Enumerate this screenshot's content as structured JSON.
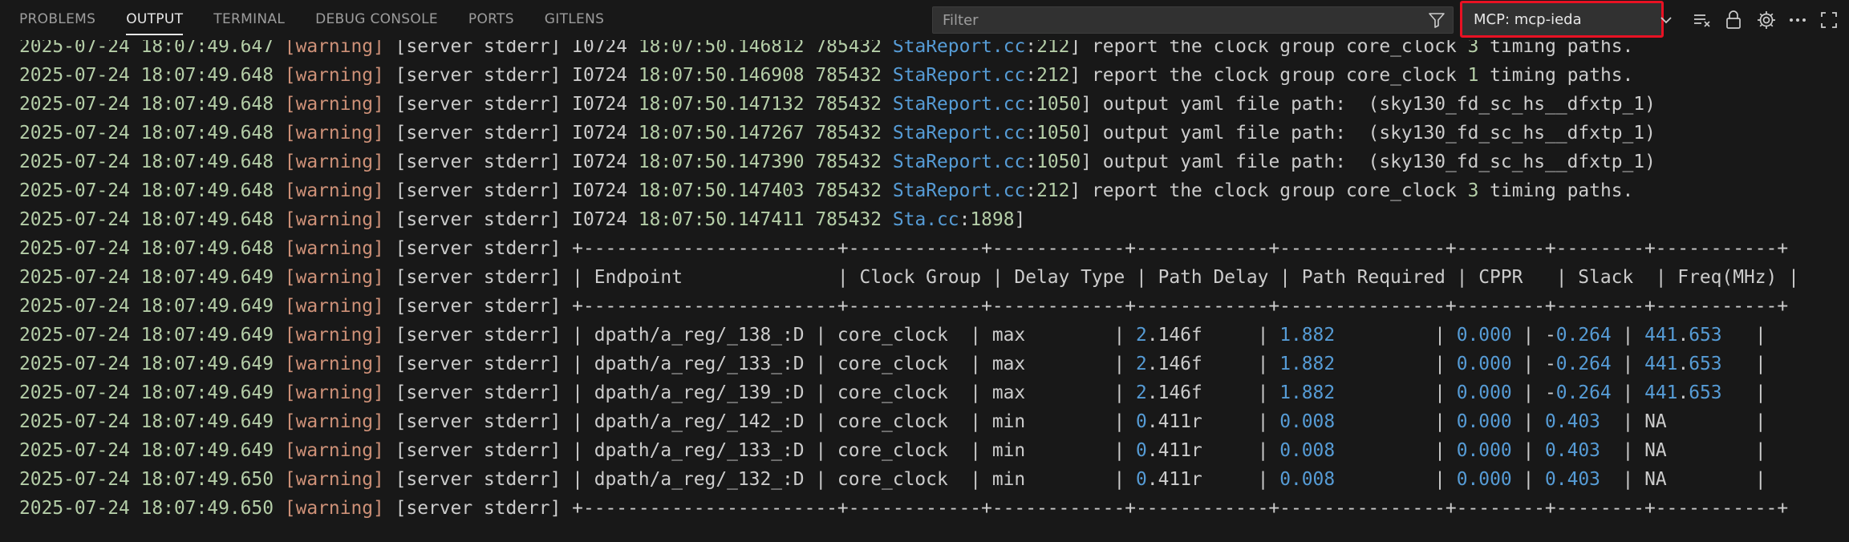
{
  "tabs": [
    {
      "label": "PROBLEMS",
      "active": false
    },
    {
      "label": "OUTPUT",
      "active": true
    },
    {
      "label": "TERMINAL",
      "active": false
    },
    {
      "label": "DEBUG CONSOLE",
      "active": false
    },
    {
      "label": "PORTS",
      "active": false
    },
    {
      "label": "GITLENS",
      "active": false
    }
  ],
  "filter": {
    "placeholder": "Filter",
    "value": ""
  },
  "channel": {
    "selected": "MCP: mcp-ieda"
  },
  "toolbar_icons": [
    "filter-icon",
    "chevron-down-icon",
    "clear-output-icon",
    "lock-icon",
    "gear-icon",
    "more-icon",
    "maximize-icon"
  ],
  "colors": {
    "timestamp": "#b5cea8",
    "warning": "#ce9178",
    "link": "#569cd6",
    "highlight_border": "#e81123"
  },
  "log_lines": [
    {
      "ts": "2025-07-24 18:07:49.647",
      "level": "[warning]",
      "src": "[server stderr]",
      "parts": [
        [
          "msg",
          "I0724 "
        ],
        [
          "num",
          "18:07:50.146812"
        ],
        [
          "msg",
          " "
        ],
        [
          "num",
          "785432"
        ],
        [
          "msg",
          " "
        ],
        [
          "link",
          "StaReport.cc"
        ],
        [
          "msg",
          ":"
        ],
        [
          "num",
          "212"
        ],
        [
          "msg",
          "] report the clock group core_clock "
        ],
        [
          "num",
          "3"
        ],
        [
          "msg",
          " timing paths."
        ]
      ]
    },
    {
      "ts": "2025-07-24 18:07:49.648",
      "level": "[warning]",
      "src": "[server stderr]",
      "parts": [
        [
          "msg",
          "I0724 "
        ],
        [
          "num",
          "18:07:50.146908"
        ],
        [
          "msg",
          " "
        ],
        [
          "num",
          "785432"
        ],
        [
          "msg",
          " "
        ],
        [
          "link",
          "StaReport.cc"
        ],
        [
          "msg",
          ":"
        ],
        [
          "num",
          "212"
        ],
        [
          "msg",
          "] report the clock group core_clock "
        ],
        [
          "num",
          "1"
        ],
        [
          "msg",
          " timing paths."
        ]
      ]
    },
    {
      "ts": "2025-07-24 18:07:49.648",
      "level": "[warning]",
      "src": "[server stderr]",
      "parts": [
        [
          "msg",
          "I0724 "
        ],
        [
          "num",
          "18:07:50.147132"
        ],
        [
          "msg",
          " "
        ],
        [
          "num",
          "785432"
        ],
        [
          "msg",
          " "
        ],
        [
          "link",
          "StaReport.cc"
        ],
        [
          "msg",
          ":"
        ],
        [
          "num",
          "1050"
        ],
        [
          "msg",
          "] output yaml file path:  (sky130_fd_sc_hs__dfxtp_1)"
        ]
      ]
    },
    {
      "ts": "2025-07-24 18:07:49.648",
      "level": "[warning]",
      "src": "[server stderr]",
      "parts": [
        [
          "msg",
          "I0724 "
        ],
        [
          "num",
          "18:07:50.147267"
        ],
        [
          "msg",
          " "
        ],
        [
          "num",
          "785432"
        ],
        [
          "msg",
          " "
        ],
        [
          "link",
          "StaReport.cc"
        ],
        [
          "msg",
          ":"
        ],
        [
          "num",
          "1050"
        ],
        [
          "msg",
          "] output yaml file path:  (sky130_fd_sc_hs__dfxtp_1)"
        ]
      ]
    },
    {
      "ts": "2025-07-24 18:07:49.648",
      "level": "[warning]",
      "src": "[server stderr]",
      "parts": [
        [
          "msg",
          "I0724 "
        ],
        [
          "num",
          "18:07:50.147390"
        ],
        [
          "msg",
          " "
        ],
        [
          "num",
          "785432"
        ],
        [
          "msg",
          " "
        ],
        [
          "link",
          "StaReport.cc"
        ],
        [
          "msg",
          ":"
        ],
        [
          "num",
          "1050"
        ],
        [
          "msg",
          "] output yaml file path:  (sky130_fd_sc_hs__dfxtp_1)"
        ]
      ]
    },
    {
      "ts": "2025-07-24 18:07:49.648",
      "level": "[warning]",
      "src": "[server stderr]",
      "parts": [
        [
          "msg",
          "I0724 "
        ],
        [
          "num",
          "18:07:50.147403"
        ],
        [
          "msg",
          " "
        ],
        [
          "num",
          "785432"
        ],
        [
          "msg",
          " "
        ],
        [
          "link",
          "StaReport.cc"
        ],
        [
          "msg",
          ":"
        ],
        [
          "num",
          "212"
        ],
        [
          "msg",
          "] report the clock group core_clock "
        ],
        [
          "num",
          "3"
        ],
        [
          "msg",
          " timing paths."
        ]
      ]
    },
    {
      "ts": "2025-07-24 18:07:49.648",
      "level": "[warning]",
      "src": "[server stderr]",
      "parts": [
        [
          "msg",
          "I0724 "
        ],
        [
          "num",
          "18:07:50.147411"
        ],
        [
          "msg",
          " "
        ],
        [
          "num",
          "785432"
        ],
        [
          "msg",
          " "
        ],
        [
          "link",
          "Sta.cc"
        ],
        [
          "msg",
          ":"
        ],
        [
          "num",
          "1898"
        ],
        [
          "msg",
          "]"
        ]
      ]
    },
    {
      "ts": "2025-07-24 18:07:49.648",
      "level": "[warning]",
      "src": "[server stderr]",
      "parts": [
        [
          "msg",
          "+-----------------------+------------+------------+------------+---------------+--------+--------+-----------+"
        ]
      ]
    },
    {
      "ts": "2025-07-24 18:07:49.649",
      "level": "[warning]",
      "src": "[server stderr]",
      "parts": [
        [
          "msg",
          "| Endpoint              | Clock Group | Delay Type | Path Delay | Path Required | CPPR   | Slack  | Freq(MHz) |"
        ]
      ]
    },
    {
      "ts": "2025-07-24 18:07:49.649",
      "level": "[warning]",
      "src": "[server stderr]",
      "parts": [
        [
          "msg",
          "+-----------------------+------------+------------+------------+---------------+--------+--------+-----------+"
        ]
      ]
    },
    {
      "ts": "2025-07-24 18:07:49.649",
      "level": "[warning]",
      "src": "[server stderr]",
      "parts": [
        [
          "msg",
          "| dpath/a_reg/_138_:D | core_clock  | max        | "
        ],
        [
          "cell",
          "2"
        ],
        [
          "msg",
          ".146f     | "
        ],
        [
          "cell",
          "1.882"
        ],
        [
          "msg",
          "         | "
        ],
        [
          "cell",
          "0.000"
        ],
        [
          "msg",
          " | -"
        ],
        [
          "cell",
          "0.264"
        ],
        [
          "msg",
          " | "
        ],
        [
          "cell",
          "441"
        ],
        [
          "msg",
          "."
        ],
        [
          "cell",
          "653"
        ],
        [
          "msg",
          "   |"
        ]
      ]
    },
    {
      "ts": "2025-07-24 18:07:49.649",
      "level": "[warning]",
      "src": "[server stderr]",
      "parts": [
        [
          "msg",
          "| dpath/a_reg/_133_:D | core_clock  | max        | "
        ],
        [
          "cell",
          "2"
        ],
        [
          "msg",
          ".146f     | "
        ],
        [
          "cell",
          "1.882"
        ],
        [
          "msg",
          "         | "
        ],
        [
          "cell",
          "0.000"
        ],
        [
          "msg",
          " | -"
        ],
        [
          "cell",
          "0.264"
        ],
        [
          "msg",
          " | "
        ],
        [
          "cell",
          "441"
        ],
        [
          "msg",
          "."
        ],
        [
          "cell",
          "653"
        ],
        [
          "msg",
          "   |"
        ]
      ]
    },
    {
      "ts": "2025-07-24 18:07:49.649",
      "level": "[warning]",
      "src": "[server stderr]",
      "parts": [
        [
          "msg",
          "| dpath/a_reg/_139_:D | core_clock  | max        | "
        ],
        [
          "cell",
          "2"
        ],
        [
          "msg",
          ".146f     | "
        ],
        [
          "cell",
          "1.882"
        ],
        [
          "msg",
          "         | "
        ],
        [
          "cell",
          "0.000"
        ],
        [
          "msg",
          " | -"
        ],
        [
          "cell",
          "0.264"
        ],
        [
          "msg",
          " | "
        ],
        [
          "cell",
          "441"
        ],
        [
          "msg",
          "."
        ],
        [
          "cell",
          "653"
        ],
        [
          "msg",
          "   |"
        ]
      ]
    },
    {
      "ts": "2025-07-24 18:07:49.649",
      "level": "[warning]",
      "src": "[server stderr]",
      "parts": [
        [
          "msg",
          "| dpath/a_reg/_142_:D | core_clock  | min        | "
        ],
        [
          "cell",
          "0"
        ],
        [
          "msg",
          ".411r     | "
        ],
        [
          "cell",
          "0.008"
        ],
        [
          "msg",
          "         | "
        ],
        [
          "cell",
          "0.000"
        ],
        [
          "msg",
          " | "
        ],
        [
          "cell",
          "0.403"
        ],
        [
          "msg",
          "  | NA        |"
        ]
      ]
    },
    {
      "ts": "2025-07-24 18:07:49.649",
      "level": "[warning]",
      "src": "[server stderr]",
      "parts": [
        [
          "msg",
          "| dpath/a_reg/_133_:D | core_clock  | min        | "
        ],
        [
          "cell",
          "0"
        ],
        [
          "msg",
          ".411r     | "
        ],
        [
          "cell",
          "0.008"
        ],
        [
          "msg",
          "         | "
        ],
        [
          "cell",
          "0.000"
        ],
        [
          "msg",
          " | "
        ],
        [
          "cell",
          "0.403"
        ],
        [
          "msg",
          "  | NA        |"
        ]
      ]
    },
    {
      "ts": "2025-07-24 18:07:49.650",
      "level": "[warning]",
      "src": "[server stderr]",
      "parts": [
        [
          "msg",
          "| dpath/a_reg/_132_:D | core_clock  | min        | "
        ],
        [
          "cell",
          "0"
        ],
        [
          "msg",
          ".411r     | "
        ],
        [
          "cell",
          "0.008"
        ],
        [
          "msg",
          "         | "
        ],
        [
          "cell",
          "0.000"
        ],
        [
          "msg",
          " | "
        ],
        [
          "cell",
          "0.403"
        ],
        [
          "msg",
          "  | NA        |"
        ]
      ]
    },
    {
      "ts": "2025-07-24 18:07:49.650",
      "level": "[warning]",
      "src": "[server stderr]",
      "parts": [
        [
          "msg",
          "+-----------------------+------------+------------+------------+---------------+--------+--------+-----------+"
        ]
      ]
    }
  ]
}
